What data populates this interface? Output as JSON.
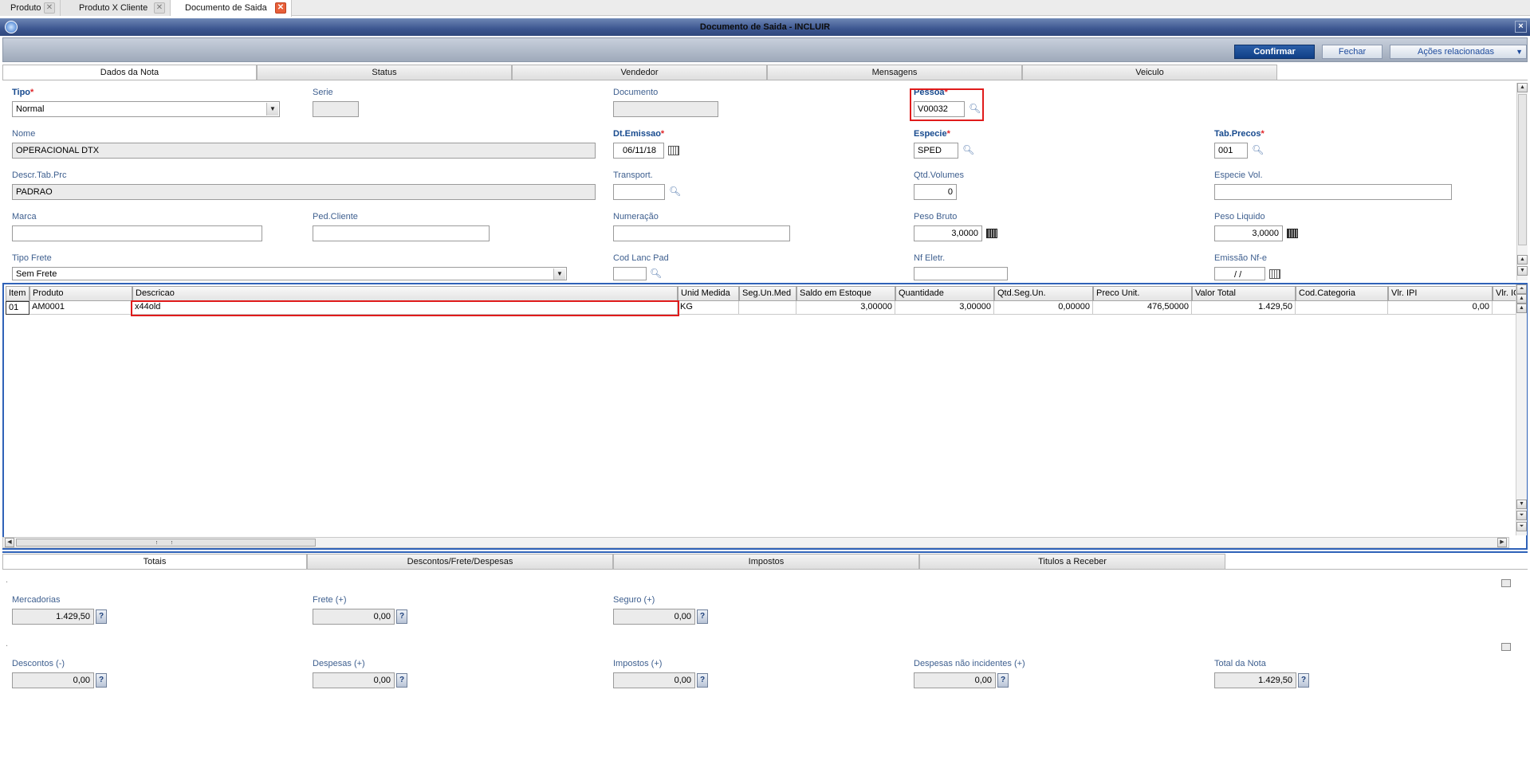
{
  "doc_tabs": [
    {
      "label": "Produto"
    },
    {
      "label": "Produto X Cliente"
    },
    {
      "label": "Documento de Saida"
    }
  ],
  "window": {
    "title": "Documento de Saida - INCLUIR",
    "close": "×"
  },
  "actions": {
    "confirmar": "Confirmar",
    "fechar": "Fechar",
    "acoes": "Ações relacionadas"
  },
  "header_tabs": [
    "Dados da Nota",
    "Status",
    "Vendedor",
    "Mensagens",
    "Veiculo"
  ],
  "form": {
    "tipo": {
      "label": "Tipo",
      "value": "Normal"
    },
    "serie": {
      "label": "Serie",
      "value": ""
    },
    "documento": {
      "label": "Documento",
      "value": ""
    },
    "pessoa": {
      "label": "Pessoa",
      "value": "V00032"
    },
    "nome": {
      "label": "Nome",
      "value": "OPERACIONAL DTX"
    },
    "dt_emissao": {
      "label": "Dt.Emissao",
      "value": "06/11/18"
    },
    "especie": {
      "label": "Especie",
      "value": "SPED"
    },
    "tab_precos": {
      "label": "Tab.Precos",
      "value": "001"
    },
    "descr_tab_prc": {
      "label": "Descr.Tab.Prc",
      "value": "PADRAO"
    },
    "transport": {
      "label": "Transport.",
      "value": ""
    },
    "qtd_volumes": {
      "label": "Qtd.Volumes",
      "value": "0"
    },
    "especie_vol": {
      "label": "Especie Vol.",
      "value": ""
    },
    "marca": {
      "label": "Marca",
      "value": ""
    },
    "ped_cliente": {
      "label": "Ped.Cliente",
      "value": ""
    },
    "numeracao": {
      "label": "Numeração",
      "value": ""
    },
    "peso_bruto": {
      "label": "Peso Bruto",
      "value": "3,0000"
    },
    "peso_liquido": {
      "label": "Peso Liquido",
      "value": "3,0000"
    },
    "tipo_frete": {
      "label": "Tipo Frete",
      "value": "Sem Frete"
    },
    "cod_lanc_pad": {
      "label": "Cod Lanc Pad",
      "value": ""
    },
    "nf_eletr": {
      "label": "Nf Eletr.",
      "value": ""
    },
    "emissao_nfe": {
      "label": "Emissão Nf-e",
      "value": "/ /"
    }
  },
  "grid": {
    "columns": [
      "Item",
      "Produto",
      "Descricao",
      "Unid Medida",
      "Seg.Un.Med",
      "Saldo em Estoque",
      "Quantidade",
      "Qtd.Seg.Un.",
      "Preco Unit.",
      "Valor Total",
      "Cod.Categoria",
      "Vlr. IPI",
      "Vlr. IC"
    ],
    "rows": [
      [
        "01",
        "AM0001",
        "x44old",
        "KG",
        "",
        "3,00000",
        "3,00000",
        "0,00000",
        "476,50000",
        "1.429,50",
        "",
        "0,00",
        ""
      ]
    ]
  },
  "footer_tabs": [
    "Totais",
    "Descontos/Frete/Despesas",
    "Impostos",
    "Titulos a Receber"
  ],
  "totals": {
    "section_marker": ".",
    "mercadorias": {
      "label": "Mercadorias",
      "value": "1.429,50"
    },
    "frete": {
      "label": "Frete (+)",
      "value": "0,00"
    },
    "seguro": {
      "label": "Seguro (+)",
      "value": "0,00"
    },
    "descontos": {
      "label": "Descontos (-)",
      "value": "0,00"
    },
    "despesas": {
      "label": "Despesas (+)",
      "value": "0,00"
    },
    "impostos": {
      "label": "Impostos (+)",
      "value": "0,00"
    },
    "despesas_nao_inc": {
      "label": "Despesas não incidentes (+)",
      "value": "0,00"
    },
    "total_nota": {
      "label": "Total da Nota",
      "value": "1.429,50"
    },
    "help": "?"
  },
  "colors": {
    "accent": "#103f86",
    "highlight": "#e01b1b",
    "label": "#3e5f8f"
  }
}
